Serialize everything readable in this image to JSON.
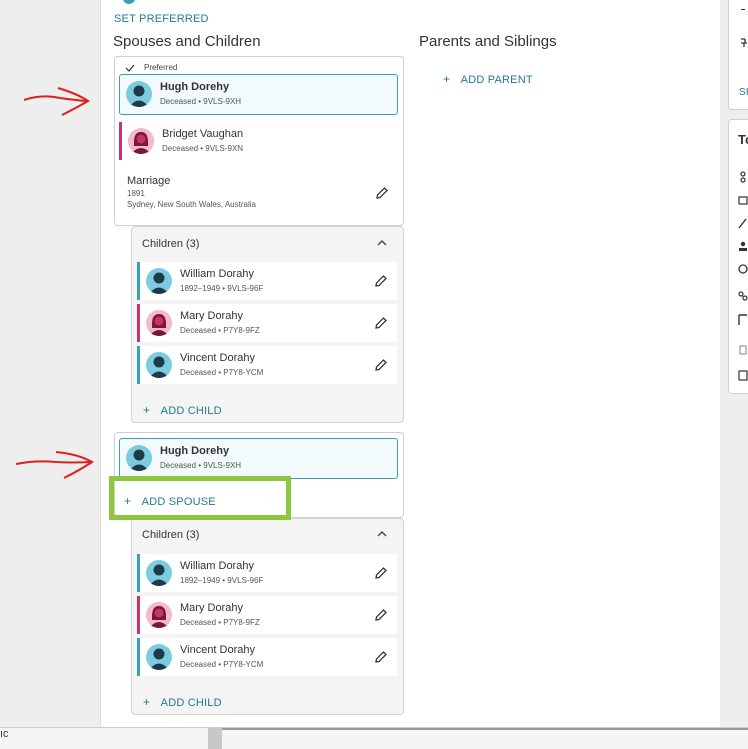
{
  "set_preferred": "SET PREFERRED",
  "spouses_title": "Spouses and Children",
  "parents_title": "Parents and Siblings",
  "add_parent": "ADD PARENT",
  "preferred_label": "Preferred",
  "family1": {
    "father": {
      "name": "Hugh Dorehy",
      "meta": "Deceased • 9VLS-9XH"
    },
    "mother": {
      "name": "Bridget Vaughan",
      "meta": "Deceased • 9VLS-9XN"
    },
    "marriage": {
      "label": "Marriage",
      "year": "1891",
      "place": "Sydney, New South Wales, Australia"
    },
    "children_title": "Children (3)",
    "children": [
      {
        "name": "William Dorahy",
        "meta": "1892–1949 • 9VLS-96F",
        "sex": "male"
      },
      {
        "name": "Mary Dorahy",
        "meta": "Deceased • P7Y8-9FZ",
        "sex": "female"
      },
      {
        "name": "Vincent Dorahy",
        "meta": "Deceased • P7Y8-YCM",
        "sex": "male"
      }
    ],
    "add_child": "ADD CHILD"
  },
  "family2": {
    "father": {
      "name": "Hugh Dorehy",
      "meta": "Deceased • 9VLS-9XH"
    },
    "add_spouse": "ADD SPOUSE",
    "children_title": "Children (3)",
    "children": [
      {
        "name": "William Dorahy",
        "meta": "1892–1949 • 9VLS-96F",
        "sex": "male"
      },
      {
        "name": "Mary Dorahy",
        "meta": "Deceased • P7Y8-9FZ",
        "sex": "female"
      },
      {
        "name": "Vincent Dorahy",
        "meta": "Deceased • P7Y8-YCM",
        "sex": "male"
      }
    ],
    "add_child": "ADD CHILD"
  },
  "right_panel": {
    "sh_label": "SH",
    "to_label": "To"
  },
  "bottom_cut": "ıc",
  "colors": {
    "accent": "#247a8a",
    "male": "#3ba0b6",
    "female": "#c2366a",
    "arrow": "#e0201c",
    "highlight": "#8dc63f"
  }
}
